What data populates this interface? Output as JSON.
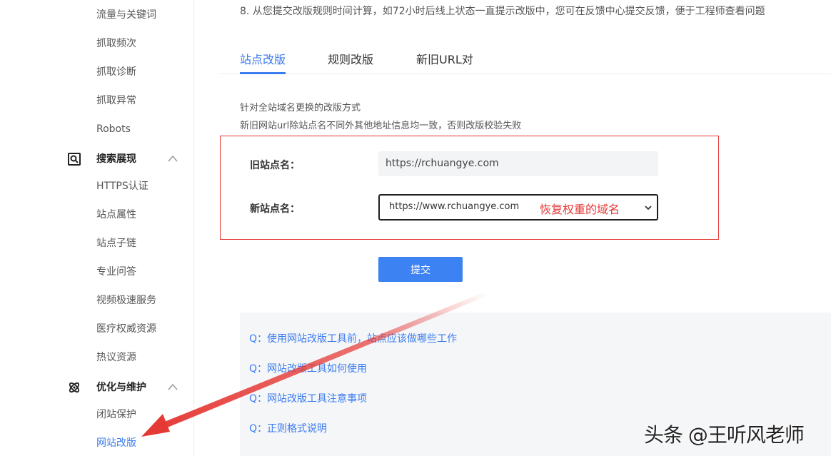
{
  "sidebar": {
    "items_top": [
      "流量与关键词",
      "抓取频次",
      "抓取诊断",
      "抓取异常",
      "Robots"
    ],
    "group_search": {
      "label": "搜索展现",
      "items": [
        "HTTPS认证",
        "站点属性",
        "站点子链",
        "专业问答",
        "视频极速服务",
        "医疗权威资源",
        "热议资源"
      ]
    },
    "group_optimize": {
      "label": "优化与维护",
      "items": [
        "闭站保护",
        "网站改版"
      ]
    }
  },
  "notice": "8. 从您提交改版规则时间计算，如72小时后线上状态一直提示改版中，您可在反馈中心提交反馈，便于工程师查看问题",
  "tabs": [
    "站点改版",
    "规则改版",
    "新旧URL对"
  ],
  "description": {
    "line1": "针对全站域名更换的改版方式",
    "line2": "新旧网站url除站点名不同外其他地址信息均一致，否则改版校验失败"
  },
  "form": {
    "old_label": "旧站点名：",
    "old_value": "https://rchuangye.com",
    "new_label": "新站点名：",
    "new_value": "https://www.rchuangye.com",
    "annotation": "恢复权重的域名"
  },
  "submit_label": "提交",
  "faq": [
    "Q：使用网站改版工具前，站点应该做哪些工作",
    "Q：网站改版工具如何使用",
    "Q：网站改版工具注意事项",
    "Q：正则格式说明"
  ],
  "watermark": "头条 @王听风老师",
  "colors": {
    "accent": "#3b7cf0",
    "button": "#3d82f2",
    "annotation": "#e53935"
  }
}
